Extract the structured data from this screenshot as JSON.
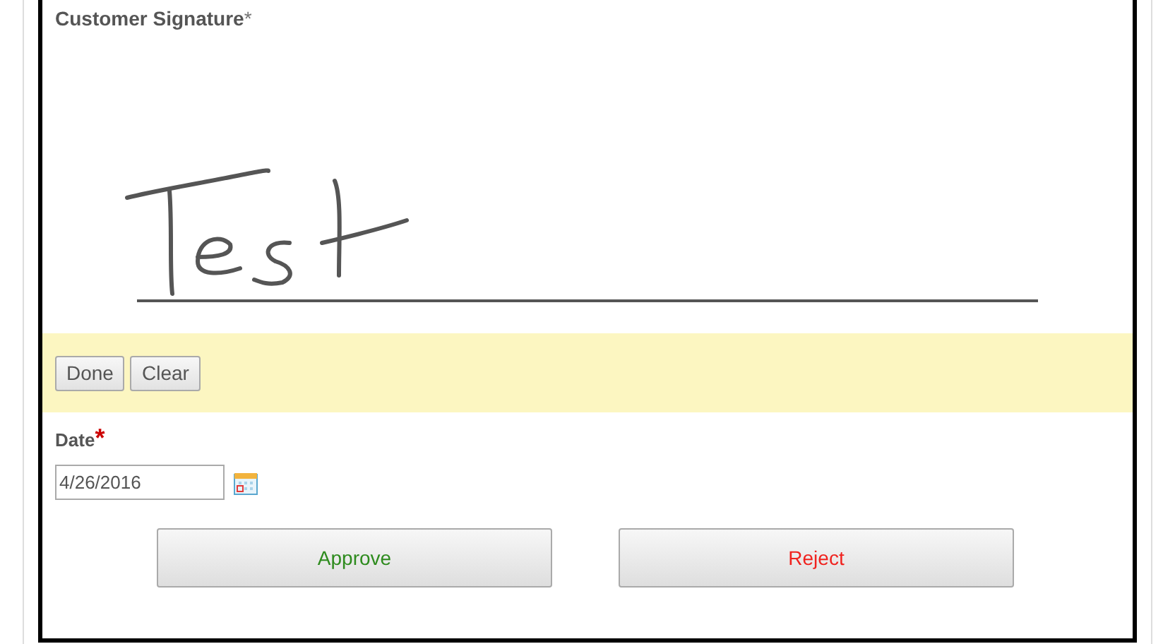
{
  "signature": {
    "label": "Customer Signature",
    "required_mark": "*",
    "buttons": [
      "Done",
      "Clear"
    ]
  },
  "date": {
    "label": "Date",
    "required_mark": "*",
    "value": "4/26/2016"
  },
  "actions": [
    {
      "label": "Approve",
      "kind": "approve"
    },
    {
      "label": "Reject",
      "kind": "reject"
    }
  ]
}
